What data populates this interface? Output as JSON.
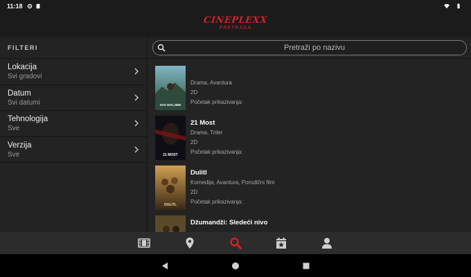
{
  "status_bar": {
    "time": "11:18"
  },
  "header": {
    "brand": "CINEPLEXX",
    "subtitle": "PRETRAGA"
  },
  "sidebar": {
    "title": "FILTERI",
    "filters": [
      {
        "label": "Lokacija",
        "value": "Svi gradovi"
      },
      {
        "label": "Datum",
        "value": "Svi datumi"
      },
      {
        "label": "Tehnologija",
        "value": "Sve"
      },
      {
        "label": "Verzija",
        "value": "Sve"
      }
    ]
  },
  "search": {
    "placeholder": "Pretraži po nazivu"
  },
  "movies": [
    {
      "title": "",
      "genre": "Drama, Avantura",
      "format": "2D",
      "start_label": "Početak prikazivanja:",
      "poster_text": "ZOV DIVLJINE",
      "poster_colors": [
        "#6fa3b8",
        "#2c4a3a"
      ]
    },
    {
      "title": "21 Most",
      "genre": "Drama, Triler",
      "format": "2D",
      "start_label": "Početak prikazivanja:",
      "poster_text": "21 MOST",
      "poster_colors": [
        "#4a1010",
        "#0e0e14"
      ]
    },
    {
      "title": "Dulitl",
      "genre": "Komedija, Avantura, Porodični film",
      "format": "2D",
      "start_label": "Početak prikazivanja:",
      "poster_text": "DULITL",
      "poster_colors": [
        "#b88a3a",
        "#3a2a18"
      ]
    },
    {
      "title": "Džumandži: Sledeći nivo",
      "genre": "",
      "format": "",
      "start_label": "",
      "poster_text": "",
      "poster_colors": [
        "#8a6a3a",
        "#2a3a2a"
      ]
    }
  ],
  "nav": {
    "items": [
      "film-icon",
      "location-pin-icon",
      "search-icon",
      "calendar-star-icon",
      "user-icon"
    ],
    "active": "search-icon",
    "active_color": "#d4202a",
    "inactive_color": "#cfcfcf"
  }
}
